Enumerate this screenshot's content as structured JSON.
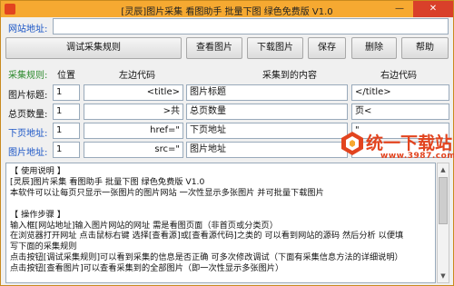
{
  "window": {
    "title": "[灵辰]图片采集 看图助手 批量下图 绿色免费版 V1.0",
    "min_glyph": "—",
    "close_glyph": "✕"
  },
  "url_row": {
    "label": "网站地址:",
    "value": ""
  },
  "toolbar": {
    "test_rule": "调试采集规则",
    "view_images": "查看图片",
    "download_images": "下载图片",
    "save": "保存",
    "delete": "删除",
    "help": "帮助"
  },
  "rules": {
    "header": {
      "title": "采集规则:",
      "position": "位置",
      "left_code": "左边代码",
      "content": "采集到的内容",
      "right_code": "右边代码"
    },
    "rows": [
      {
        "label": "图片标题:",
        "position": "1",
        "left": "<title>",
        "content": "图片标题",
        "right": "</title>"
      },
      {
        "label": "总页数量:",
        "position": "1",
        "left": ">共",
        "content": "总页数量",
        "right": "页<"
      },
      {
        "label": "下页地址:",
        "position": "1",
        "left": "href=\"",
        "content": "下页地址",
        "right": "\""
      },
      {
        "label": "图片地址:",
        "position": "1",
        "left": "src=\"",
        "content": "图片地址",
        "right": "\""
      }
    ]
  },
  "help_text": [
    "【 使用说明 】",
    "[灵辰]图片采集 看图助手 批量下图 绿色免费版 V1.0",
    "本软件可以让每页只显示一张图片的图片网站 一次性显示多张图片 并可批量下载图片",
    "",
    "【 操作步骤 】",
    "输入框[网站地址]输入图片网站的网址 需是看图页面（非首页或分类页）",
    "在浏览器打开网址 点击鼠标右键 选择[查看源]或[查看源代码]之类的 可以看到网站的源码 然后分析 以便填",
    "写下面的采集规则",
    "点击按钮[调试采集规则]可以看到采集的信息是否正确 可多次修改调试（下面有采集信息方法的详细说明）",
    "点击按钮[查看图片]可以查看采集到的全部图片（即一次性显示多张图片）"
  ],
  "watermark": {
    "text": "统一下载站",
    "url": "www.3987.com"
  },
  "colors": {
    "titlebar": "#f6a931",
    "label_blue": "#1a55c6",
    "label_green": "#2e8b2e",
    "watermark": "#e2441f"
  }
}
